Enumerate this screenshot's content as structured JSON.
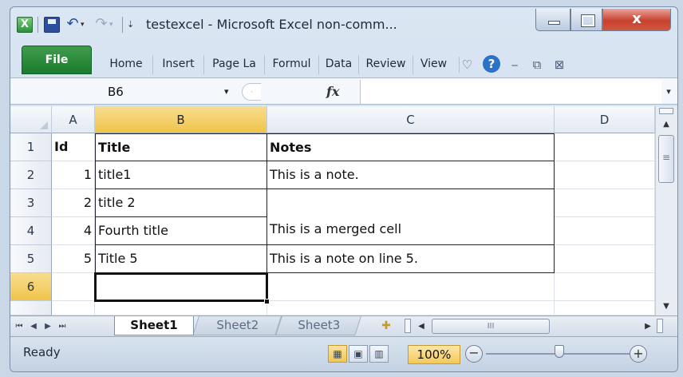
{
  "window": {
    "title": "testexcel - Microsoft Excel non-comm...",
    "close_glyph": "x"
  },
  "qat": {
    "logo_glyph": "X",
    "undo_glyph": "↶",
    "redo_glyph": "↷",
    "dropdown_glyph": "▾",
    "customize_glyph": "⇣"
  },
  "ribbon": {
    "file_tab": "File",
    "tabs": [
      "Home",
      "Insert",
      "Page La",
      "Formul",
      "Data",
      "Review",
      "View"
    ],
    "icons": {
      "minimize_ribbon": "♡",
      "help": "?",
      "ribbon_minimize": "⎯",
      "ribbon_restore": "⧉",
      "ribbon_close": "⊠"
    }
  },
  "formula_bar": {
    "name_box": "B6",
    "name_box_dd": "▾",
    "fx_label": "fx",
    "formula_value": "",
    "expand_glyph": "▾"
  },
  "columns": [
    "A",
    "B",
    "C",
    "D"
  ],
  "rows": [
    "1",
    "2",
    "3",
    "4",
    "5",
    "6"
  ],
  "cells": {
    "A1": "Id",
    "B1": "Title",
    "C1": "Notes",
    "A2": "1",
    "B2": "title1",
    "C2": "This is a note.",
    "A3": "2",
    "B3": "title 2",
    "A4": "4",
    "B4": "Fourth title",
    "C4": "This is a merged cell",
    "A5": "5",
    "B5": "Title 5",
    "C5": "This is a note on line 5.",
    "A6": "",
    "B6": ""
  },
  "selection": {
    "active_cell": "B6",
    "active_column": "B",
    "active_row": "6"
  },
  "sheets": {
    "tabs": [
      "Sheet1",
      "Sheet2",
      "Sheet3"
    ],
    "active": "Sheet1",
    "nav": [
      "⏮",
      "◀",
      "▶",
      "⏭"
    ]
  },
  "status": {
    "text": "Ready",
    "zoom": "100%",
    "zoom_out": "−",
    "zoom_in": "+",
    "hscroll_grip": "III"
  },
  "colors": {
    "file_tab": "#2b8a3e",
    "selected_header": "#f3c74f",
    "close_button": "#c6412e",
    "help_icon": "#2b73c9"
  }
}
